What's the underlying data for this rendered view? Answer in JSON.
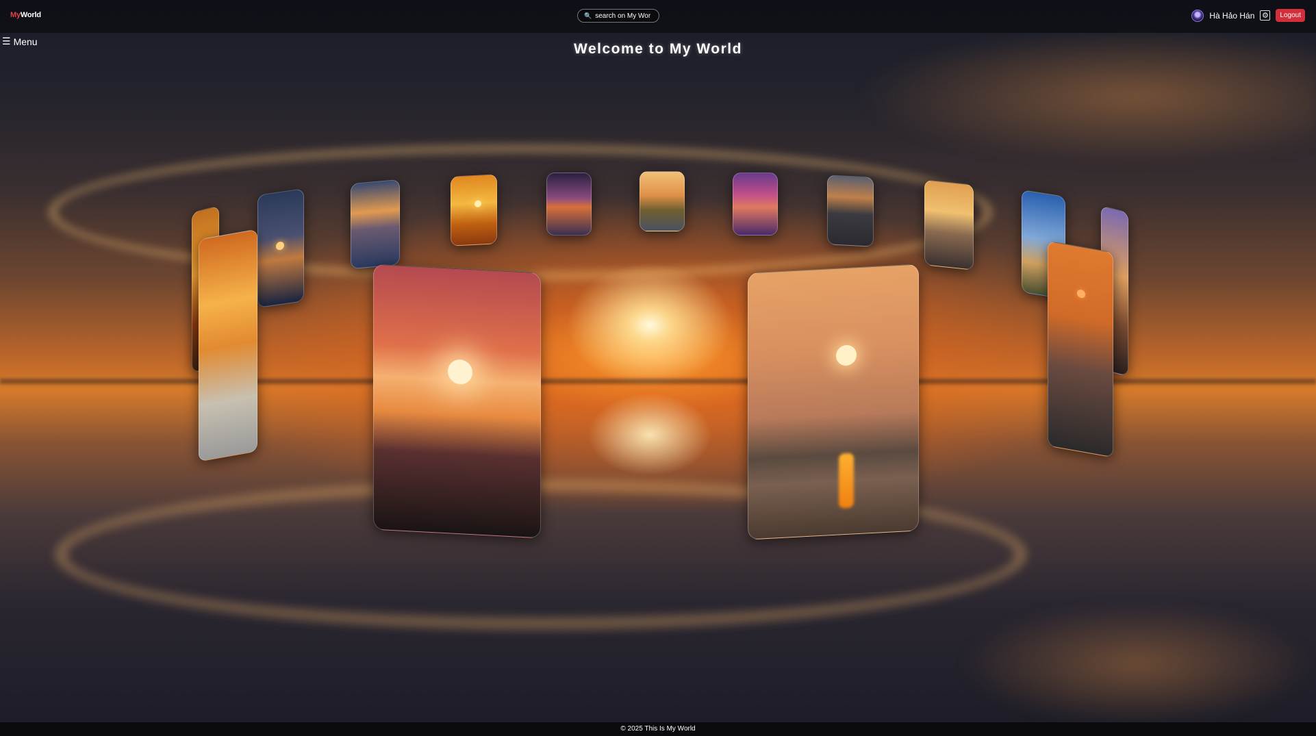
{
  "brand": {
    "my": "My",
    "world": "World"
  },
  "search": {
    "placeholder": "search on My Wor"
  },
  "user": {
    "name": "Hà Hảo Hán",
    "logout_label": "Logout"
  },
  "menu": {
    "label": "Menu"
  },
  "page_title": "Welcome to My World",
  "footer": "© 2025 This Is My World",
  "colors": {
    "brand_red": "#e0434a",
    "logout_red": "#d32f3a"
  },
  "icons": [
    "search-icon",
    "avatar",
    "gear-icon",
    "menu-icon"
  ]
}
